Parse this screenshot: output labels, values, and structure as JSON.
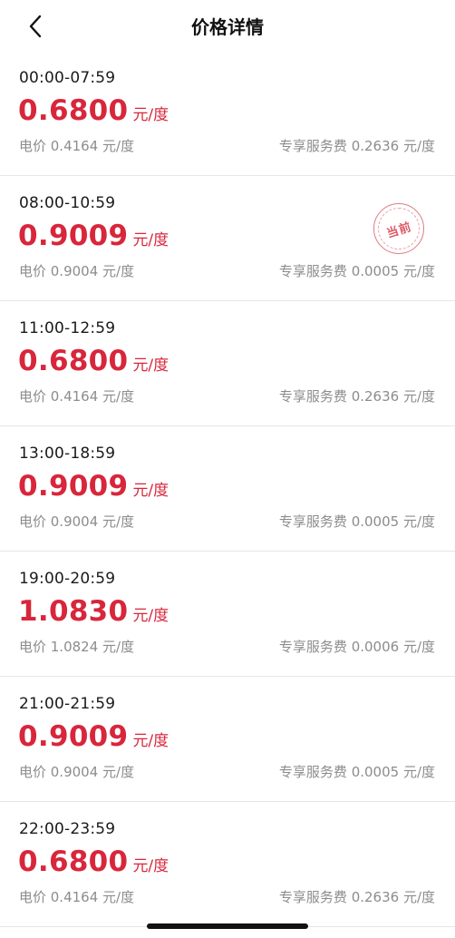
{
  "header": {
    "title": "价格详情",
    "back_icon": "chevron-left-icon"
  },
  "colors": {
    "price": "#d8263b",
    "subtext": "#8c8c8c",
    "divider": "#e6e6e6"
  },
  "rows": [
    {
      "time": "00:00-07:59",
      "price": "0.6800",
      "unit": "元/度",
      "electricity": "电价 0.4164 元/度",
      "service": "专享服务费 0.2636 元/度"
    },
    {
      "time": "08:00-10:59",
      "price": "0.9009",
      "unit": "元/度",
      "electricity": "电价 0.9004 元/度",
      "service": "专享服务费 0.0005 元/度",
      "stamp": "当前"
    },
    {
      "time": "11:00-12:59",
      "price": "0.6800",
      "unit": "元/度",
      "electricity": "电价 0.4164 元/度",
      "service": "专享服务费 0.2636 元/度"
    },
    {
      "time": "13:00-18:59",
      "price": "0.9009",
      "unit": "元/度",
      "electricity": "电价 0.9004 元/度",
      "service": "专享服务费 0.0005 元/度"
    },
    {
      "time": "19:00-20:59",
      "price": "1.0830",
      "unit": "元/度",
      "electricity": "电价 1.0824 元/度",
      "service": "专享服务费 0.0006 元/度"
    },
    {
      "time": "21:00-21:59",
      "price": "0.9009",
      "unit": "元/度",
      "electricity": "电价 0.9004 元/度",
      "service": "专享服务费 0.0005 元/度"
    },
    {
      "time": "22:00-23:59",
      "price": "0.6800",
      "unit": "元/度",
      "electricity": "电价 0.4164 元/度",
      "service": "专享服务费 0.2636 元/度"
    }
  ]
}
